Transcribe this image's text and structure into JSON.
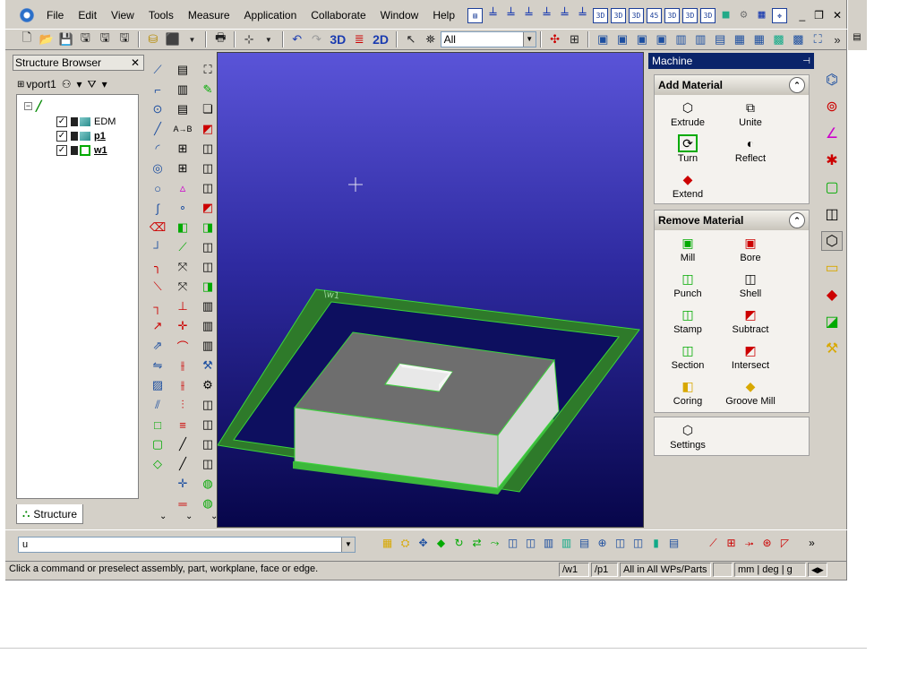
{
  "menu": [
    "File",
    "Edit",
    "View",
    "Tools",
    "Measure",
    "Application",
    "Collaborate",
    "Window",
    "Help"
  ],
  "menu_icons": [
    "assembly-tree-icon",
    "workplane-1-icon",
    "workplane-2-icon",
    "workplane-3-icon",
    "workplane-4-icon",
    "workplane-5-icon",
    "workplane-6-icon"
  ],
  "menu_view_icons": [
    "3D",
    "3D",
    "3D",
    "45",
    "3D",
    "3D",
    "3D"
  ],
  "toolbar": {
    "mode_3d": "3D",
    "mode_2d": "2D",
    "filter_value": "All"
  },
  "structure": {
    "title": "Structure Browser",
    "vport": "vport1",
    "items": [
      {
        "label": "EDM",
        "bold": false
      },
      {
        "label": "p1",
        "bold": true
      },
      {
        "label": "w1",
        "bold": true
      }
    ],
    "tab": "Structure"
  },
  "machine": {
    "title": "Machine",
    "add_section": "Add Material",
    "add_buttons": [
      "Extrude",
      "Unite",
      "Turn",
      "Reflect",
      "Extend"
    ],
    "remove_section": "Remove Material",
    "remove_buttons": [
      "Mill",
      "Bore",
      "Punch",
      "Shell",
      "Stamp",
      "Subtract",
      "Section",
      "Intersect",
      "Coring",
      "Groove Mill"
    ],
    "settings": "Settings"
  },
  "viewport": {
    "workplane_label": "\\w1"
  },
  "command": {
    "value": "u"
  },
  "status": {
    "message": "Click a command or preselect assembly, part, workplane, face or edge.",
    "workplane": "/w1",
    "part": "/p1",
    "scope": "All in All WPs/Parts",
    "units": "mm | deg | g"
  },
  "colors": {
    "accent": "#0a246a",
    "workplane_green": "#2e8b2e",
    "viewport_top": "#5a54d8",
    "viewport_bottom": "#07064a"
  }
}
